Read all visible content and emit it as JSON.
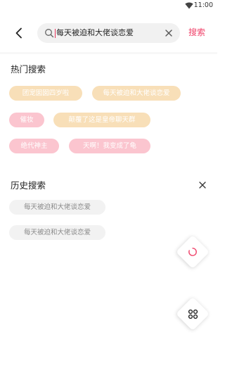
{
  "status_bar": {
    "time": "11:00",
    "wifi_icon": "wifi-icon"
  },
  "search": {
    "back_icon": "chevron-left-icon",
    "search_icon": "search-icon",
    "query": "每天被迫和大佬谈恋爱",
    "clear_icon": "close-icon",
    "submit_label": "搜索",
    "accent_color": "#f0446b"
  },
  "hot": {
    "title": "热门搜索",
    "tags": [
      {
        "label": "团宠囡囡四岁啦",
        "color": "orange"
      },
      {
        "label": "每天被迫和大佬谈恋爱",
        "color": "orange"
      },
      {
        "label": "催妆",
        "color": "pink"
      },
      {
        "label": "颠覆了这是皇帝聊天群",
        "color": "orange"
      },
      {
        "label": "绝代神主",
        "color": "pink"
      },
      {
        "label": "天啊！我变成了龟",
        "color": "pink"
      }
    ]
  },
  "history": {
    "title": "历史搜索",
    "clear_icon": "close-icon",
    "items": [
      {
        "label": "每天被迫和大佬谈恋爱"
      },
      {
        "label": "每天被迫和大佬谈恋爱"
      }
    ]
  },
  "floating": {
    "refresh_icon": "loading-icon",
    "apps_icon": "apps-icon"
  },
  "colors": {
    "orange_tag": "#f8dfb8",
    "pink_tag": "#fbc5cf",
    "history_tag": "#f2f2f2"
  }
}
